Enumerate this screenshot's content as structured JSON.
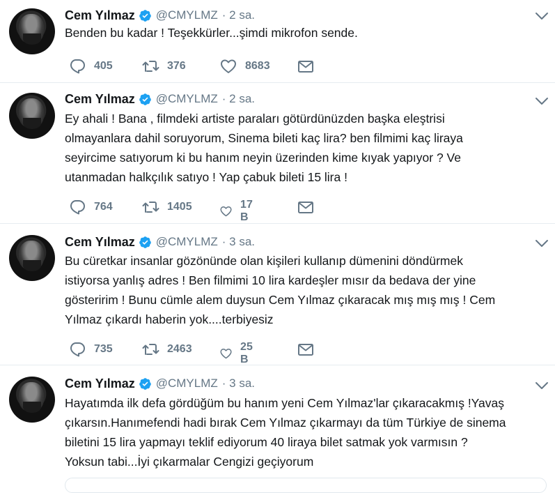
{
  "tweets": [
    {
      "name": "Cem Yılmaz",
      "handle": "@CMYLMZ",
      "time": "· 2 sa.",
      "text": "Benden bu kadar ! Teşekkürler...şimdi mikrofon sende.",
      "replies": "405",
      "retweets": "376",
      "likes": "8683"
    },
    {
      "name": "Cem Yılmaz",
      "handle": "@CMYLMZ",
      "time": "· 2 sa.",
      "text": "Ey ahali ! Bana , filmdeki artiste paraları götürdünüzden başka eleştrisi\nolmayanlara dahil soruyorum, Sinema bileti kaç lira?  ben filmimi kaç liraya\nseyircime satıyorum ki bu hanım neyin üzerinden kime kıyak yapıyor ?  Ve\nutanmadan halkçılık satıyo ! Yap çabuk bileti 15 lira !",
      "replies": "764",
      "retweets": "1405",
      "likes": "17 B"
    },
    {
      "name": "Cem Yılmaz",
      "handle": "@CMYLMZ",
      "time": "· 3 sa.",
      "text": "Bu cüretkar insanlar gözönünde olan kişileri kullanıp dümenini döndürmek\nistiyorsa yanlış adres ! Ben filmimi 10 lira kardeşler mısır da bedava der yine\ngösteririm ! Bunu cümle alem duysun Cem Yılmaz çıkaracak mış mış mış ! Cem\nYılmaz çıkardı haberin yok....terbiyesiz",
      "replies": "735",
      "retweets": "2463",
      "likes": "25 B"
    },
    {
      "name": "Cem Yılmaz",
      "handle": "@CMYLMZ",
      "time": "· 3 sa.",
      "text": "Hayatımda ilk defa gördüğüm bu hanım yeni Cem Yılmaz'lar çıkaracakmış !Yavaş\nçıkarsın.Hanımefendi hadi bırak Cem Yılmaz çıkarmayı da tüm Türkiye de sinema\nbiletini 15 lira yapmayı teklif ediyorum 40 liraya bilet satmak yok varmısın ?\nYoksun tabi...İyi çıkarmalar Cengizi geçiyorum"
    }
  ],
  "colors": {
    "verified": "#1da1f2",
    "muted": "#657786",
    "divider": "#e6ecf0"
  }
}
